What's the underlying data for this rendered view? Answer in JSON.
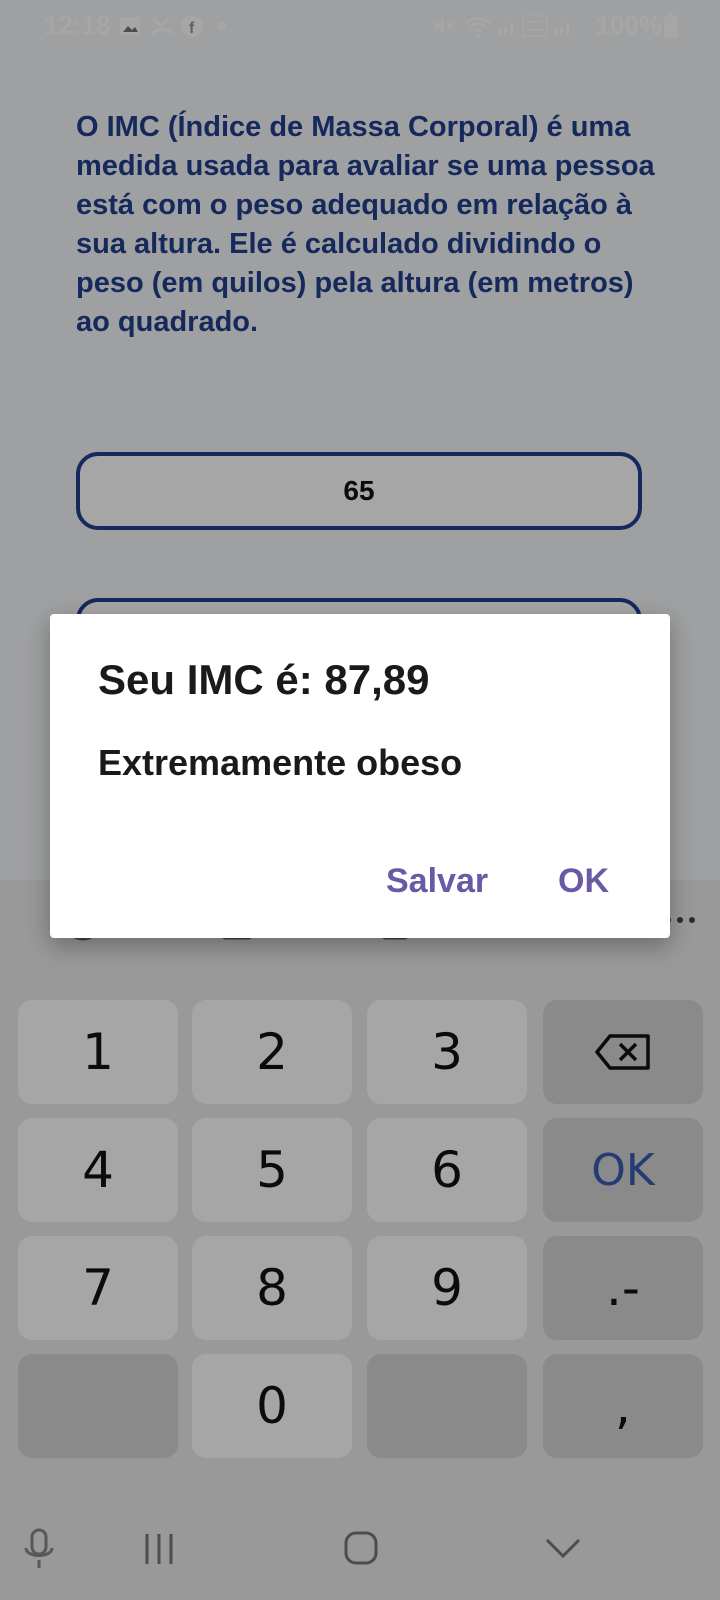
{
  "status_bar": {
    "time": "12:18",
    "battery": "100%"
  },
  "content": {
    "description": "O IMC (Índice de Massa Corporal) é uma medida usada para avaliar se uma pessoa está com o peso adequado em relação à sua altura. Ele é calculado dividindo o peso (em quilos) pela altura (em metros) ao quadrado.",
    "weight_value": "65",
    "height_value": ""
  },
  "dialog": {
    "title": "Seu IMC é: 87,89",
    "message": "Extremamente obeso",
    "save_label": "Salvar",
    "ok_label": "OK"
  },
  "keyboard": {
    "keys": [
      "1",
      "2",
      "3",
      "4",
      "5",
      "6",
      "OK",
      "7",
      "8",
      "9",
      ".-",
      "0",
      ","
    ],
    "ok_color": "#3a5bb0"
  },
  "colors": {
    "accent": "#23408e",
    "dialog_button": "#6a59a5"
  }
}
